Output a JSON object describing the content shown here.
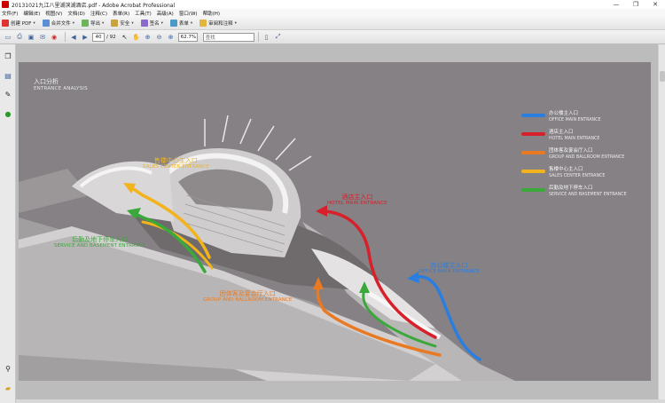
{
  "window": {
    "title": "20131021九江八里湖滨湖酒店.pdf - Adobe Acrobat Professional",
    "controls": [
      "—",
      "❐",
      "✕"
    ]
  },
  "menu": [
    "文件(F)",
    "编辑(E)",
    "视图(V)",
    "文档(D)",
    "注释(C)",
    "表单(R)",
    "工具(T)",
    "高级(A)",
    "窗口(W)",
    "帮助(H)"
  ],
  "toolbar": {
    "create_pdf": "创建 PDF",
    "combine": "合并文件",
    "export": "导出",
    "secure": "安全",
    "sign": "签名",
    "forms": "表单",
    "review": "审阅和注释"
  },
  "nav": {
    "page_current": "40",
    "page_total": "/ 92",
    "zoom": "62.7%",
    "search_placeholder": "查找"
  },
  "page": {
    "heading_cn": "入口分析",
    "heading_en": "ENTRANCE ANALYSIS",
    "legend": [
      {
        "cn": "办公楼主入口",
        "en": "OFFICE MAIN ENTRANCE",
        "color": "#2a7ee0"
      },
      {
        "cn": "酒店主入口",
        "en": "HOTEL MAIN ENTRANCE",
        "color": "#d8202a"
      },
      {
        "cn": "团体客及宴会厅入口",
        "en": "GROUP AND BALLROOM ENTRANCE",
        "color": "#ea7a22"
      },
      {
        "cn": "售楼中心主入口",
        "en": "SALES CENTER ENTRANCE",
        "color": "#f2b31c"
      },
      {
        "cn": "后勤及地下停车入口",
        "en": "SERVICE AND BASEMENT ENTRANCE",
        "color": "#3aa83a"
      }
    ],
    "labels": {
      "sales": {
        "cn": "售楼中心主入口",
        "en": "SALES CENTER ENTRANCE",
        "color": "#f2b31c"
      },
      "service": {
        "cn": "后勤及地下停车入口",
        "en": "SERVICE AND BASEMENT ENTRANCE",
        "color": "#3aa83a"
      },
      "hotel": {
        "cn": "酒店主入口",
        "en": "HOTEL MAIN ENTRANCE",
        "color": "#d8202a"
      },
      "office": {
        "cn": "办公楼主入口",
        "en": "OFFICE MAIN ENTRANCE",
        "color": "#2a7ee0"
      },
      "group": {
        "cn": "团体客及宴会厅入口",
        "en": "GROUP AND BALLROOM ENTRANCE",
        "color": "#ea7a22"
      }
    }
  }
}
